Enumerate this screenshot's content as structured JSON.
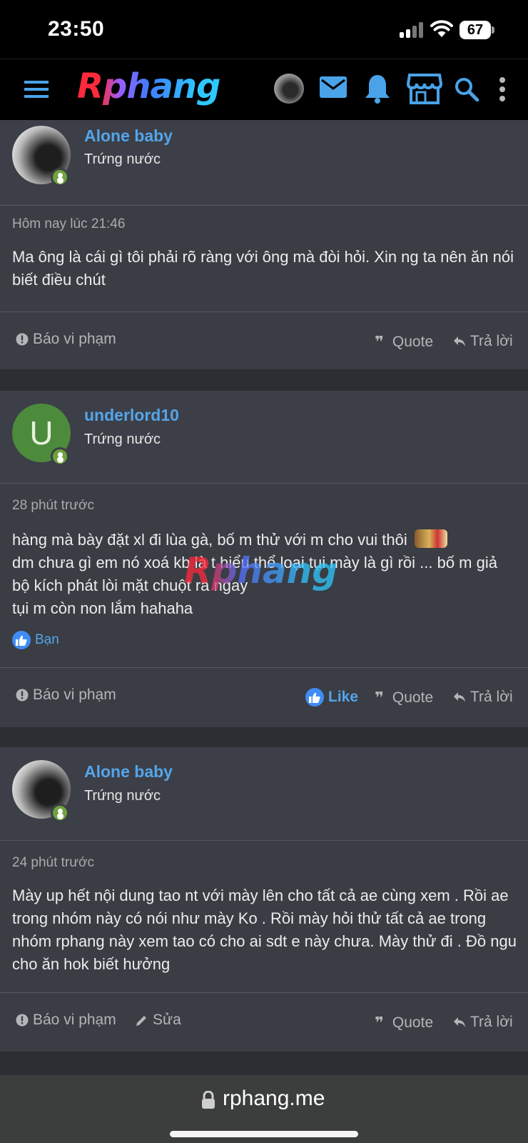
{
  "status_bar": {
    "time": "23:50",
    "battery": "67"
  },
  "header": {
    "logo": "Rphang",
    "icons": [
      "menu-icon",
      "avatar",
      "mail-icon",
      "bell-icon",
      "store-icon",
      "search-icon",
      "more-vertical-icon"
    ],
    "accent": "#54a5ea"
  },
  "posts": [
    {
      "username": "Alone baby",
      "user_title": "Trứng nước",
      "time": "Hôm nay lúc 21:46",
      "body": "Ma ông là cái gì tôi phải rõ ràng với ông mà đòi hỏi. Xin ng ta nên ăn nói biết điều chút",
      "actions": {
        "report": "Báo vi phạm",
        "quote": "Quote",
        "reply": "Trả lời"
      }
    },
    {
      "username": "underlord10",
      "avatar_letter": "U",
      "user_title": "Trứng nước",
      "time": "28 phút trước",
      "body_lines": [
        "hàng mà bày đặt xl đi lùa gà, bố m thử với m cho vui thôi",
        "dm chưa gì em nó xoá kb là t hiểu thể loại tụi mày là gì rồi ... bố m giả bộ kích phát lòi mặt chuột ra ngay",
        "tụi m còn non lắm hahaha"
      ],
      "reaction": "Bạn",
      "actions": {
        "report": "Báo vi phạm",
        "like": "Like",
        "quote": "Quote",
        "reply": "Trả lời"
      }
    },
    {
      "username": "Alone baby",
      "user_title": "Trứng nước",
      "time": "24 phút trước",
      "body": "Mày up hết nội dung tao nt với mày lên cho tất cả ae cùng xem . Rồi ae trong nhóm này có nói như mày Ko . Rồi mày hỏi thử tất cả ae trong nhóm rphang này xem tao có cho ai sdt e này chưa. Mày thử đi . Đồ ngu cho ăn hok biết hưởng",
      "actions": {
        "report": "Báo vi phạm",
        "edit": "Sửa",
        "quote": "Quote",
        "reply": "Trả lời"
      }
    }
  ],
  "watermark": "Rphang",
  "url_bar": {
    "url": "rphang.me"
  }
}
